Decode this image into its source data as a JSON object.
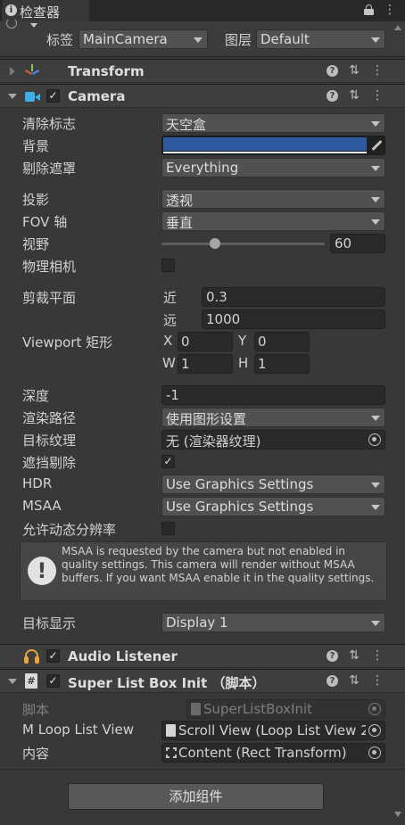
{
  "tab": {
    "title": "检查器",
    "lock_icon": "lock-icon",
    "menu_icon": "kebab-icon"
  },
  "header": {
    "tag_label": "标签",
    "tag_value": "MainCamera",
    "layer_label": "图层",
    "layer_value": "Default"
  },
  "components": {
    "transform": {
      "name": "Transform"
    },
    "camera": {
      "name": "Camera",
      "enabled": "✓"
    },
    "audio_listener": {
      "name": "Audio Listener",
      "enabled": "✓"
    },
    "super_list": {
      "name": "Super List Box Init  （脚本）",
      "enabled": "✓"
    }
  },
  "camera": {
    "clear_flags": {
      "label": "清除标志",
      "value": "天空盒"
    },
    "background": {
      "label": "背景",
      "color": "#2f5aa2"
    },
    "culling_mask": {
      "label": "剔除遮罩",
      "value": "Everything"
    },
    "projection": {
      "label": "投影",
      "value": "透视"
    },
    "fov_axis": {
      "label": "FOV 轴",
      "value": "垂直"
    },
    "fov": {
      "label": "视野",
      "value": "60",
      "slider_fraction": 0.33
    },
    "physical": {
      "label": "物理相机"
    },
    "clipping": {
      "label": "剪裁平面",
      "near_label": "近",
      "near": "0.3",
      "far_label": "远",
      "far": "1000"
    },
    "viewport": {
      "label": "Viewport 矩形",
      "x_label": "X",
      "x": "0",
      "y_label": "Y",
      "y": "0",
      "w_label": "W",
      "w": "1",
      "h_label": "H",
      "h": "1"
    },
    "depth": {
      "label": "深度",
      "value": "-1"
    },
    "rendering_path": {
      "label": "渲染路径",
      "value": "使用图形设置"
    },
    "target_texture": {
      "label": "目标纹理",
      "value": "无 (渲染器纹理)"
    },
    "occlusion": {
      "label": "遮挡剔除",
      "check": "✓"
    },
    "hdr": {
      "label": "HDR",
      "value": "Use Graphics Settings"
    },
    "msaa": {
      "label": "MSAA",
      "value": "Use Graphics Settings"
    },
    "dynamic_res": {
      "label": "允许动态分辨率"
    },
    "help": "MSAA is requested by the camera but not enabled in quality settings. This camera will render without MSAA buffers. If you want MSAA enable it in the quality settings.",
    "target_display": {
      "label": "目标显示",
      "value": "Display 1"
    }
  },
  "script": {
    "script_label": "脚本",
    "script_value": "SuperListBoxInit",
    "loop_label": "M Loop List View",
    "loop_value": "Scroll View (Loop List View 2",
    "content_label": "内容",
    "content_value": "Content (Rect Transform)"
  },
  "add_component": "添加组件"
}
